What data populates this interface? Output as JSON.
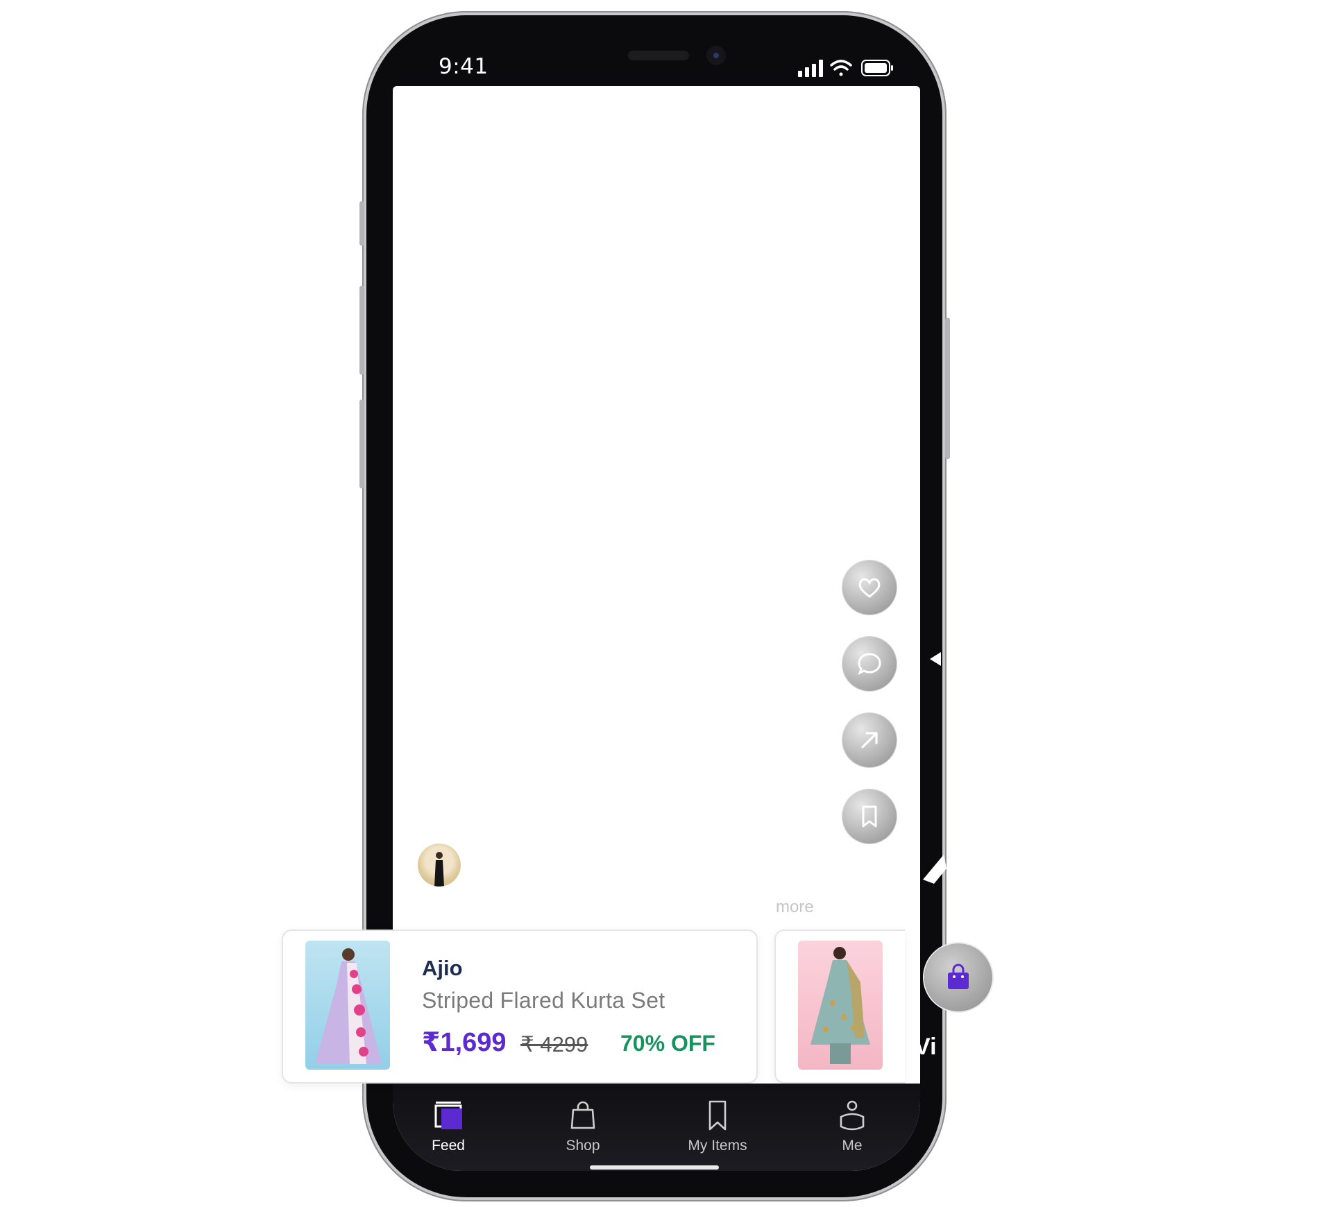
{
  "status_bar": {
    "time": "9:41"
  },
  "actions": [
    {
      "name": "like",
      "icon": "heart-icon"
    },
    {
      "name": "comment",
      "icon": "chat-icon"
    },
    {
      "name": "share",
      "icon": "share-arrow-icon"
    },
    {
      "name": "save",
      "icon": "bookmark-icon"
    }
  ],
  "feed": {
    "more_label": "more"
  },
  "product": {
    "brand": "Ajio",
    "name": "Striped Flared Kurta Set",
    "price": "₹1,699",
    "mrp": "₹ 4299",
    "discount": "70% OFF"
  },
  "shop_bubble": {
    "label": "Vi",
    "icon": "shopping-bag-icon"
  },
  "nav": {
    "items": [
      {
        "label": "Feed",
        "icon": "feed-icon",
        "active": true
      },
      {
        "label": "Shop",
        "icon": "shop-bag-icon",
        "active": false
      },
      {
        "label": "My Items",
        "icon": "bookmark-icon",
        "active": false
      },
      {
        "label": "Me",
        "icon": "profile-icon",
        "active": false
      }
    ]
  },
  "colors": {
    "accent": "#5b2ad0",
    "discount": "#16935f",
    "brand_text": "#1d2d52"
  }
}
